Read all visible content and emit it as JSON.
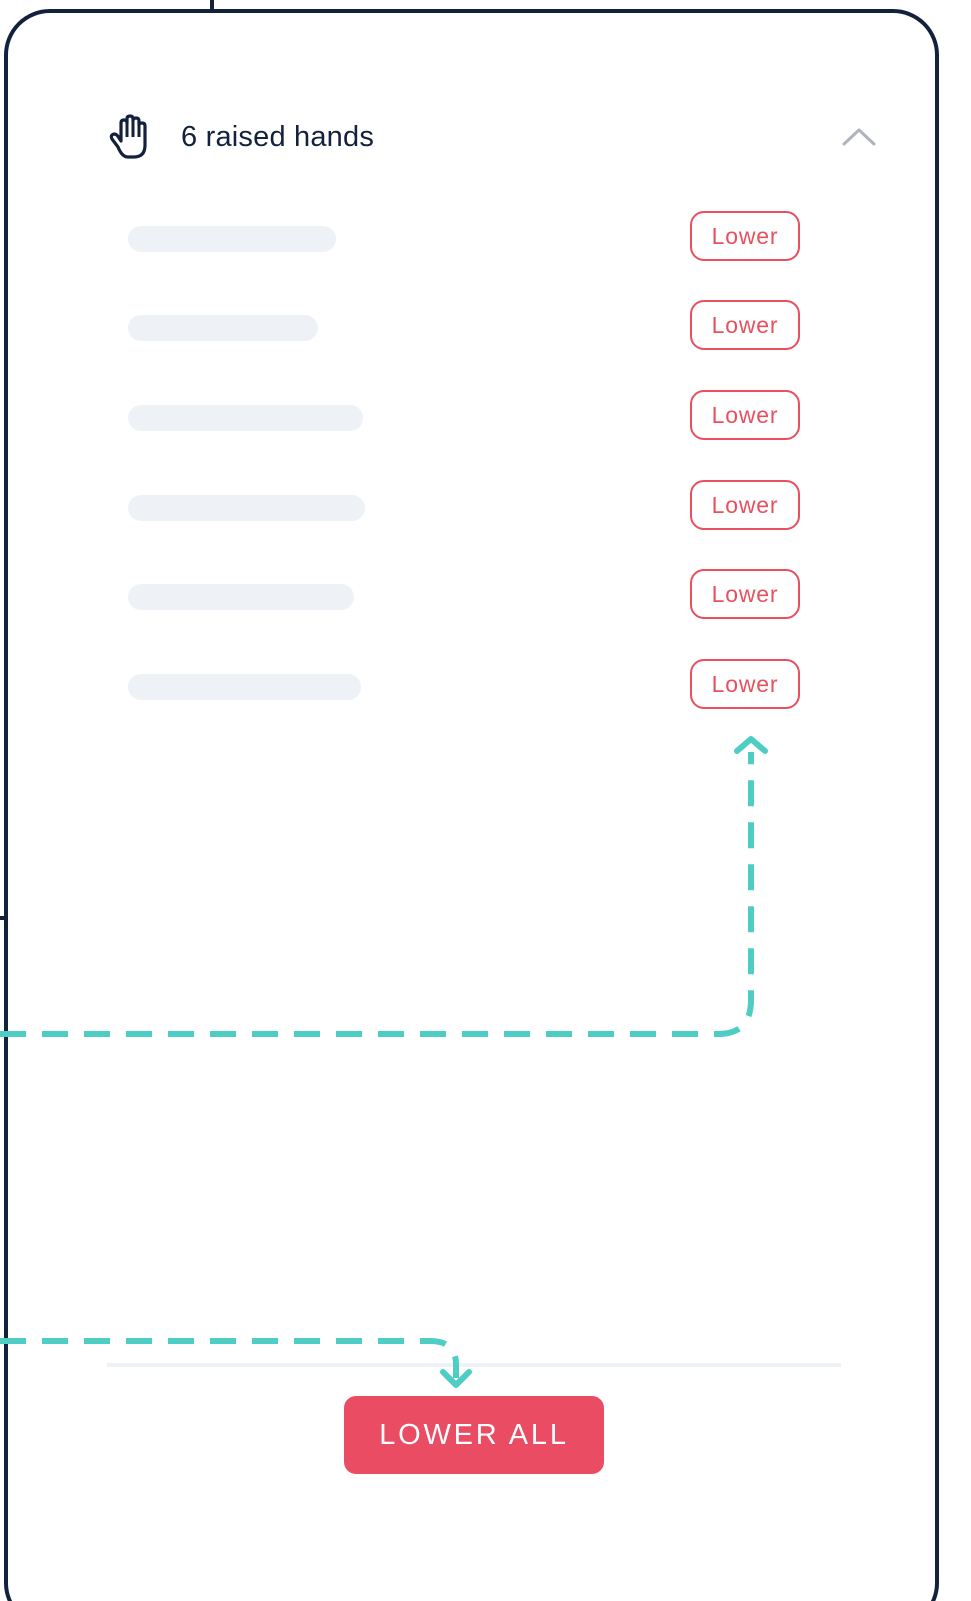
{
  "panel": {
    "title": "6 raised hands",
    "header_icon": "raised-hand-icon",
    "collapse_icon": "chevron-up-icon"
  },
  "raised_hands": [
    {
      "name": "",
      "action_label": "Lower"
    },
    {
      "name": "",
      "action_label": "Lower"
    },
    {
      "name": "",
      "action_label": "Lower"
    },
    {
      "name": "",
      "action_label": "Lower"
    },
    {
      "name": "",
      "action_label": "Lower"
    },
    {
      "name": "",
      "action_label": "Lower"
    }
  ],
  "footer": {
    "lower_all_label": "LOWER ALL"
  },
  "colors": {
    "accent": "#EA4C64",
    "outline_red": "#E8505F",
    "frame": "#13213D",
    "connector": "#4ECDC4",
    "placeholder": "#EEF1F6",
    "chevron": "#AEB3BD"
  }
}
